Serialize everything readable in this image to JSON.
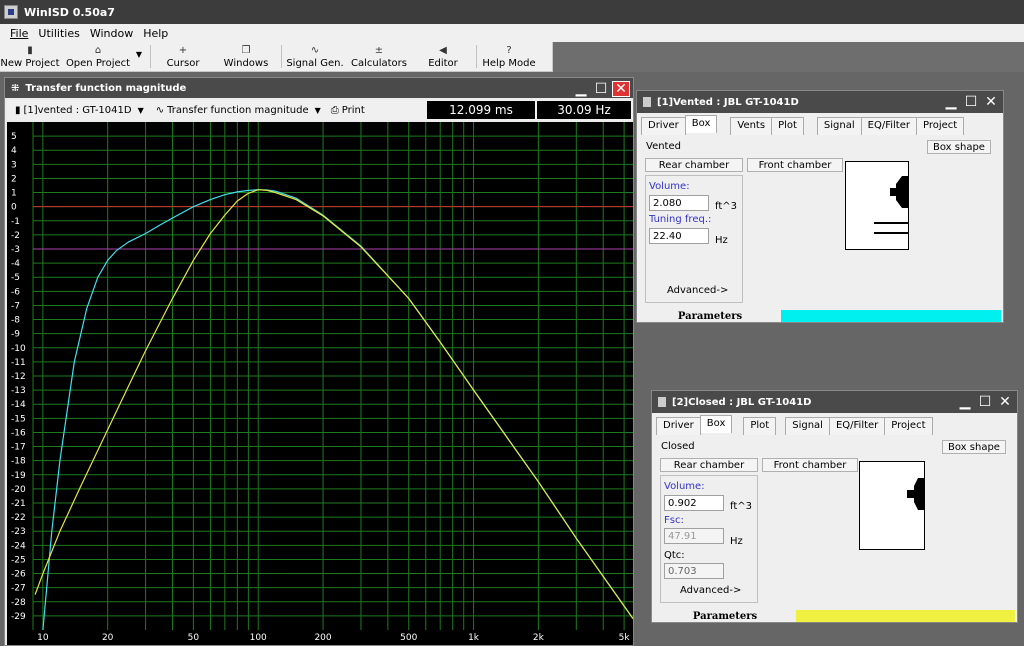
{
  "app": {
    "title": "WinISD 0.50a7"
  },
  "menu": [
    {
      "label": "File"
    },
    {
      "label": "Utilities"
    },
    {
      "label": "Window"
    },
    {
      "label": "Help"
    }
  ],
  "toolbar": {
    "new_project": "New Project",
    "open_project": "Open Project",
    "cursor": "Cursor",
    "windows": "Windows",
    "signal_gen": "Signal Gen.",
    "calculators": "Calculators",
    "editor": "Editor",
    "help_mode": "Help Mode"
  },
  "transfer_window": {
    "title": "Transfer function magnitude",
    "project_select": "[1]vented : GT-1041D",
    "plot_select": "Transfer function magnitude",
    "print_label": "Print",
    "time_readout": "12.099 ms",
    "freq_readout": "30.09 Hz"
  },
  "chart_data": {
    "type": "line",
    "title": "",
    "xlabel": "",
    "ylabel": "",
    "x_scale": "log",
    "xlim": [
      9,
      5500
    ],
    "ylim": [
      -30,
      6
    ],
    "x_ticks": [
      {
        "v": 10,
        "label": "10"
      },
      {
        "v": 20,
        "label": "20"
      },
      {
        "v": 50,
        "label": "50"
      },
      {
        "v": 100,
        "label": "100"
      },
      {
        "v": 200,
        "label": "200"
      },
      {
        "v": 500,
        "label": "500"
      },
      {
        "v": 1000,
        "label": "1k"
      },
      {
        "v": 2000,
        "label": "2k"
      },
      {
        "v": 5000,
        "label": "5k"
      }
    ],
    "y_ticks": [
      5,
      4,
      3,
      2,
      1,
      0,
      -1,
      -2,
      -3,
      -4,
      -5,
      -6,
      -7,
      -8,
      -9,
      -10,
      -11,
      -12,
      -13,
      -14,
      -15,
      -16,
      -17,
      -18,
      -19,
      -20,
      -21,
      -22,
      -23,
      -24,
      -25,
      -26,
      -27,
      -28,
      -29
    ],
    "reference_lines": [
      {
        "y": 0,
        "color": "#d03030"
      },
      {
        "y": -3,
        "color": "#b040b0"
      }
    ],
    "grid": true,
    "series": [
      {
        "color": "#40e0f0",
        "x": [
          10,
          11,
          12,
          14,
          16,
          18,
          20,
          22,
          25,
          30,
          35,
          40,
          50,
          60,
          70,
          80,
          90,
          100,
          110,
          120,
          150,
          200,
          300,
          500,
          700,
          1000,
          2000,
          3000,
          5000,
          5500
        ],
        "y": [
          -30,
          -23,
          -18,
          -11,
          -7.2,
          -5,
          -3.8,
          -3.1,
          -2.5,
          -1.9,
          -1.3,
          -0.8,
          0,
          0.5,
          0.85,
          1.05,
          1.15,
          1.2,
          1.18,
          1.1,
          0.6,
          -0.6,
          -2.8,
          -6.5,
          -9.6,
          -13,
          -19.5,
          -23.5,
          -28.3,
          -29.2
        ]
      },
      {
        "color": "#e6e640",
        "x": [
          9.2,
          10,
          12,
          15,
          20,
          25,
          30,
          40,
          50,
          60,
          70,
          80,
          90,
          100,
          110,
          120,
          150,
          200,
          300,
          500,
          700,
          1000,
          2000,
          3000,
          5000,
          5500
        ],
        "y": [
          -27.5,
          -26,
          -23,
          -19.8,
          -15.8,
          -12.7,
          -10.2,
          -6.5,
          -3.8,
          -1.9,
          -0.6,
          0.4,
          0.95,
          1.2,
          1.15,
          1,
          0.5,
          -0.65,
          -2.85,
          -6.5,
          -9.6,
          -13,
          -19.5,
          -23.5,
          -28.3,
          -29.2
        ]
      }
    ]
  },
  "vented_window": {
    "title": "[1]Vented : JBL GT-1041D",
    "tabs": [
      "Driver",
      "Box",
      "Vents",
      "Plot",
      "Signal",
      "EQ/Filter",
      "Project"
    ],
    "active_tab": "Box",
    "box_type": "Vented",
    "box_shape_btn": "Box shape",
    "rear_chamber": "Rear chamber",
    "front_chamber": "Front chamber",
    "volume_label": "Volume:",
    "volume_value": "2.080",
    "volume_unit": "ft^3",
    "tuning_label": "Tuning freq.:",
    "tuning_value": "22.40",
    "tuning_unit": "Hz",
    "advanced": "Advanced->",
    "status": "Parameters",
    "status_color": "#00f0f0"
  },
  "closed_window": {
    "title": "[2]Closed : JBL GT-1041D",
    "tabs": [
      "Driver",
      "Box",
      "Plot",
      "Signal",
      "EQ/Filter",
      "Project"
    ],
    "active_tab": "Box",
    "box_type": "Closed",
    "box_shape_btn": "Box shape",
    "rear_chamber": "Rear chamber",
    "front_chamber": "Front chamber",
    "volume_label": "Volume:",
    "volume_value": "0.902",
    "volume_unit": "ft^3",
    "fsc_label": "Fsc:",
    "fsc_value": "47.91",
    "fsc_unit": "Hz",
    "qtc_label": "Qtc:",
    "qtc_value": "0.703",
    "advanced": "Advanced->",
    "status": "Parameters",
    "status_color": "#f0f040"
  }
}
